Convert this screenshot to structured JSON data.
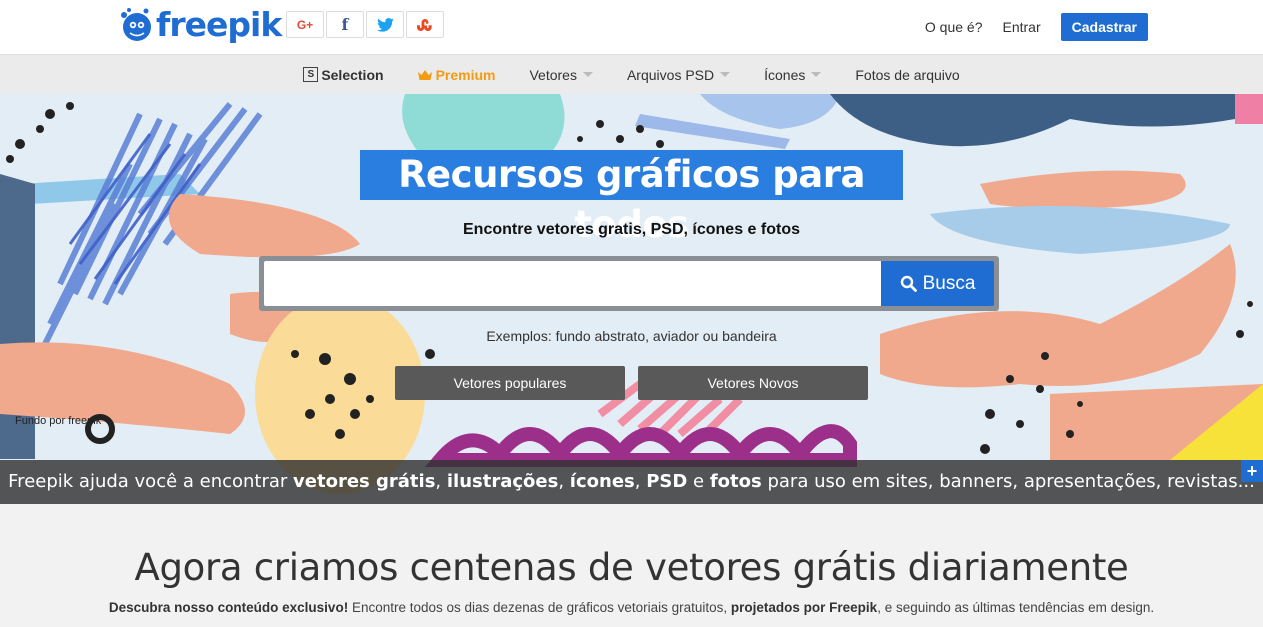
{
  "brand": {
    "name": "freepik",
    "color": "#1f6dd2"
  },
  "social": [
    {
      "id": "google-plus",
      "label": "G+"
    },
    {
      "id": "facebook",
      "label": "f"
    },
    {
      "id": "twitter",
      "label": "twitter-bird"
    },
    {
      "id": "stumbleupon",
      "label": "stumbleupon-logo"
    }
  ],
  "top_nav": {
    "what": "O que é?",
    "login": "Entrar",
    "signup": "Cadastrar"
  },
  "nav": {
    "selection_icon": "S",
    "selection": "Selection",
    "premium": "Premium",
    "vectors": "Vetores",
    "psd": "Arquivos PSD",
    "icons": "Ícones",
    "photos": "Fotos de arquivo"
  },
  "hero": {
    "title": "Recursos gráficos para todos",
    "subtitle": "Encontre vetores gratis, PSD, ícones e fotos",
    "search_placeholder": "",
    "search_button": "Busca",
    "examples": "Exemplos: fundo abstrato, aviador ou bandeira",
    "btn_popular": "Vetores populares",
    "btn_new": "Vetores Novos",
    "credit": "Fundo por freepik",
    "band": {
      "t1": "Freepik ajuda você a encontrar ",
      "b1": "vetores grátis",
      "t2": ", ",
      "b2": "ilustrações",
      "t3": ", ",
      "b3": "ícones",
      "t4": ", ",
      "b4": "PSD",
      "t5": " e ",
      "b5": "fotos",
      "t6": " para uso em sites, banners, apresentações, revistas..."
    },
    "plus": "+"
  },
  "main": {
    "heading": "Agora criamos centenas de vetores grátis diariamente",
    "desc": {
      "b1": "Descubra nosso conteúdo exclusivo!",
      "t1": " Encontre todos os dias dezenas de gráficos vetoriais gratuitos, ",
      "b2": "projetados por Freepik",
      "t2": ", e seguindo as últimas tendências em design."
    }
  },
  "colors": {
    "accent": "#1f6dd2",
    "premium": "#f39c12",
    "dark_button": "#595959"
  }
}
